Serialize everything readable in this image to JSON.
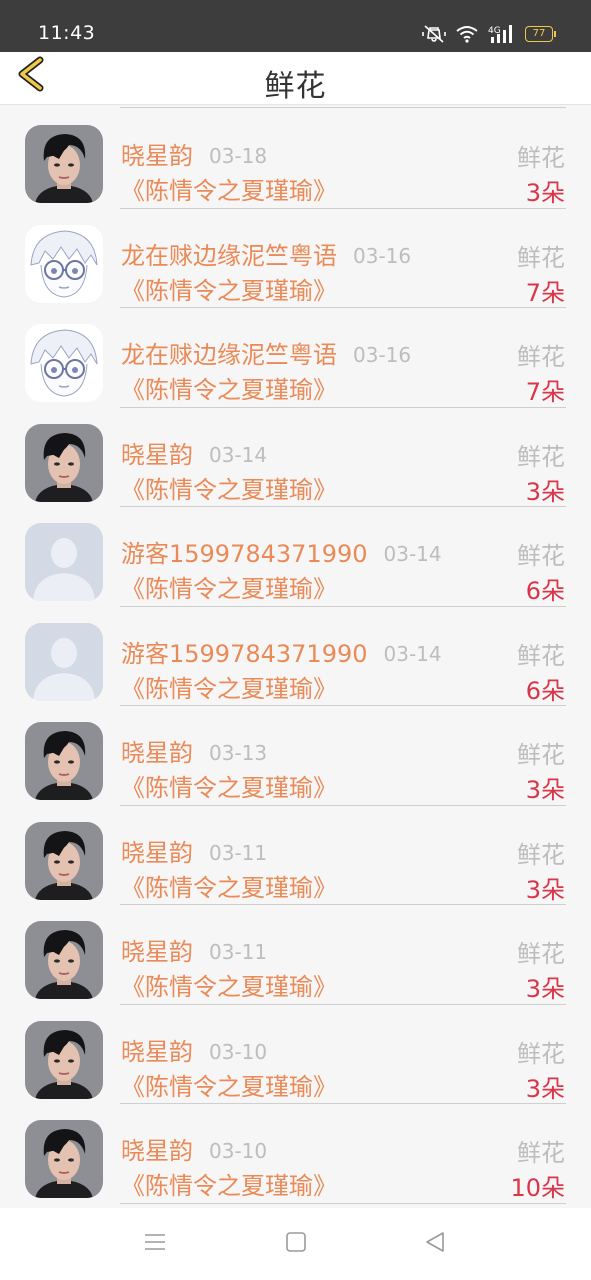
{
  "status_bar": {
    "time": "11:43",
    "battery_level": "77",
    "network_label": "4G",
    "icons": [
      "mute-vibrate-icon",
      "wifi-icon",
      "signal-icon",
      "battery-icon"
    ]
  },
  "header": {
    "title": "鲜花",
    "back_icon": "chevron-left-icon"
  },
  "gift_records": [
    {
      "user": "晓星韵",
      "date": "03-18",
      "book": "《陈情令之夏瑾瑜》",
      "gift": "鲜花",
      "count": "3朵",
      "avatar": "woman-photo"
    },
    {
      "user": "龙在赇边缘泥竺粤语",
      "date": "03-16",
      "book": "《陈情令之夏瑾瑜》",
      "gift": "鲜花",
      "count": "7朵",
      "avatar": "anime-glasses"
    },
    {
      "user": "龙在赇边缘泥竺粤语",
      "date": "03-16",
      "book": "《陈情令之夏瑾瑜》",
      "gift": "鲜花",
      "count": "7朵",
      "avatar": "anime-glasses"
    },
    {
      "user": "晓星韵",
      "date": "03-14",
      "book": "《陈情令之夏瑾瑜》",
      "gift": "鲜花",
      "count": "3朵",
      "avatar": "woman-photo"
    },
    {
      "user": "游客1599784371990",
      "date": "03-14",
      "book": "《陈情令之夏瑾瑜》",
      "gift": "鲜花",
      "count": "6朵",
      "avatar": "default-user"
    },
    {
      "user": "游客1599784371990",
      "date": "03-14",
      "book": "《陈情令之夏瑾瑜》",
      "gift": "鲜花",
      "count": "6朵",
      "avatar": "default-user"
    },
    {
      "user": "晓星韵",
      "date": "03-13",
      "book": "《陈情令之夏瑾瑜》",
      "gift": "鲜花",
      "count": "3朵",
      "avatar": "woman-photo"
    },
    {
      "user": "晓星韵",
      "date": "03-11",
      "book": "《陈情令之夏瑾瑜》",
      "gift": "鲜花",
      "count": "3朵",
      "avatar": "woman-photo"
    },
    {
      "user": "晓星韵",
      "date": "03-11",
      "book": "《陈情令之夏瑾瑜》",
      "gift": "鲜花",
      "count": "3朵",
      "avatar": "woman-photo"
    },
    {
      "user": "晓星韵",
      "date": "03-10",
      "book": "《陈情令之夏瑾瑜》",
      "gift": "鲜花",
      "count": "3朵",
      "avatar": "woman-photo"
    },
    {
      "user": "晓星韵",
      "date": "03-10",
      "book": "《陈情令之夏瑾瑜》",
      "gift": "鲜花",
      "count": "10朵",
      "avatar": "woman-photo"
    }
  ],
  "colors": {
    "name_orange": "#e98a57",
    "count_red": "#d9364a",
    "muted_gray": "#bdbdbd",
    "back_chevron": "#f0c94a"
  },
  "nav_bar": {
    "icons": [
      "menu-icon",
      "home-square-icon",
      "back-triangle-icon"
    ]
  }
}
